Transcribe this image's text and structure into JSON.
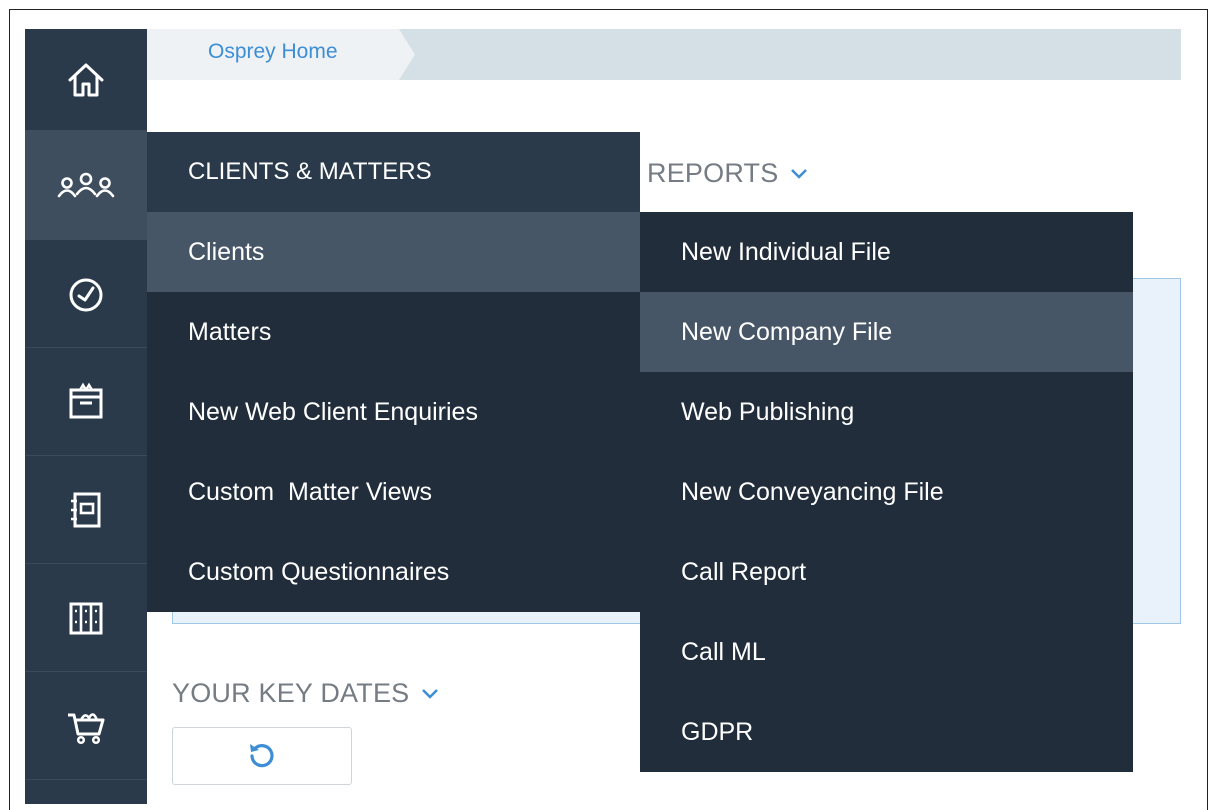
{
  "breadcrumb": {
    "home_label": "Osprey Home"
  },
  "rail": {
    "items": [
      {
        "icon": "home-icon"
      },
      {
        "icon": "clients-icon",
        "active": true
      },
      {
        "icon": "timer-icon"
      },
      {
        "icon": "calendar-icon"
      },
      {
        "icon": "address-book-icon"
      },
      {
        "icon": "library-icon"
      },
      {
        "icon": "cart-icon"
      }
    ]
  },
  "sections": {
    "reports_title": "REPORTS",
    "key_dates_title": "YOUR KEY DATES"
  },
  "clients_menu": {
    "header": "CLIENTS & MATTERS",
    "items": [
      {
        "label": "Clients",
        "highlighted": true
      },
      {
        "label": "Matters"
      },
      {
        "label": "New Web Client Enquiries"
      },
      {
        "label": "Custom  Matter Views"
      },
      {
        "label": "Custom Questionnaires"
      }
    ]
  },
  "clients_submenu": {
    "items": [
      {
        "label": "New Individual File"
      },
      {
        "label": "New Company File",
        "highlighted": true
      },
      {
        "label": "Web Publishing"
      },
      {
        "label": "New Conveyancing File"
      },
      {
        "label": "Call Report"
      },
      {
        "label": "Call ML"
      },
      {
        "label": "GDPR"
      }
    ]
  },
  "colors": {
    "rail_bg": "#2b3a4b",
    "menu_bg": "#212d3b",
    "menu_highlight": "#465667",
    "accent": "#3d8ed4"
  }
}
